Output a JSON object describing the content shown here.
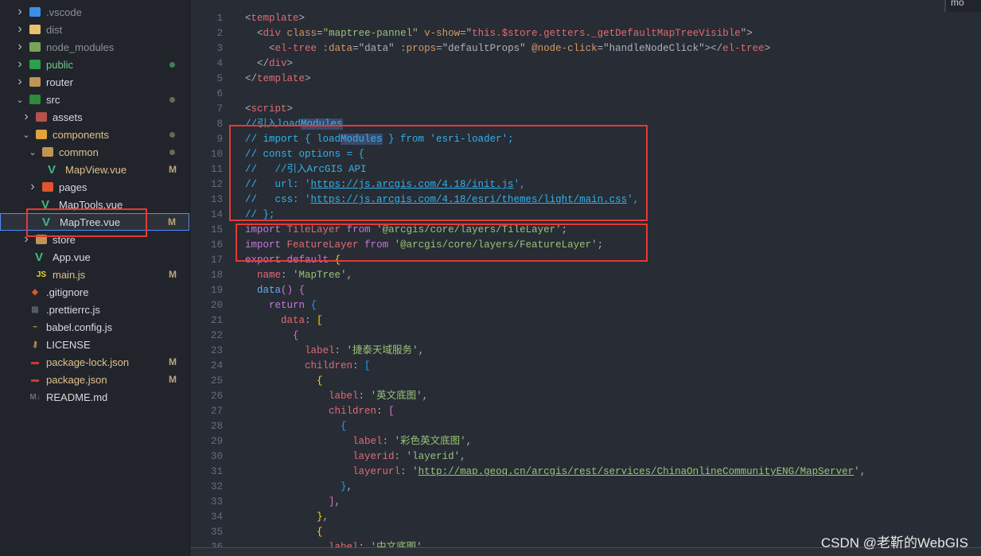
{
  "explorer": {
    "items": [
      {
        "name": ".vscode",
        "level": 0,
        "chevron": "closed",
        "icon": "vscode-folder-icon",
        "icon_color": "#3b8eea",
        "text_color": "#8b9099"
      },
      {
        "name": "dist",
        "level": 0,
        "chevron": "closed",
        "icon": "dist-folder-icon",
        "icon_color": "#e8c170",
        "text_color": "#8b9099"
      },
      {
        "name": "node_modules",
        "level": 0,
        "chevron": "closed",
        "icon": "node-folder-icon",
        "icon_color": "#7aa35a",
        "text_color": "#8b9099"
      },
      {
        "name": "public",
        "level": 0,
        "chevron": "closed",
        "icon": "public-folder-icon",
        "icon_color": "#2e9e4f",
        "text_color": "#73c991",
        "dot": "green"
      },
      {
        "name": "router",
        "level": 0,
        "chevron": "closed",
        "icon": "folder-icon",
        "icon_color": "#c09553",
        "text_color": "#d7dae0"
      },
      {
        "name": "src",
        "level": 0,
        "chevron": "open",
        "icon": "src-folder-icon",
        "icon_color": "#2e8b3e",
        "text_color": "#d7dae0",
        "dot": "gray"
      },
      {
        "name": "assets",
        "level": 1,
        "chevron": "closed",
        "icon": "assets-folder-icon",
        "icon_color": "#b5524b",
        "text_color": "#d7dae0"
      },
      {
        "name": "components",
        "level": 1,
        "chevron": "open",
        "icon": "components-folder-icon",
        "icon_color": "#e3a33b",
        "text_color": "#e2c08d",
        "dot": "gray"
      },
      {
        "name": "common",
        "level": 2,
        "chevron": "open",
        "icon": "folder-open-icon",
        "icon_color": "#c09553",
        "text_color": "#e2c08d",
        "dot": "gray"
      },
      {
        "name": "MapView.vue",
        "level": 3,
        "chevron": "none",
        "icon": "vue-icon",
        "icon_color": "#41b883",
        "text_color": "#e2c08d",
        "status": "M"
      },
      {
        "name": "pages",
        "level": 2,
        "chevron": "closed",
        "icon": "pages-folder-icon",
        "icon_color": "#e0552e",
        "text_color": "#d7dae0"
      },
      {
        "name": "MapTools.vue",
        "level": 2,
        "chevron": "none",
        "icon": "vue-icon",
        "icon_color": "#41b883",
        "text_color": "#d7dae0"
      },
      {
        "name": "MapTree.vue",
        "level": 2,
        "chevron": "none",
        "icon": "vue-icon",
        "icon_color": "#41b883",
        "text_color": "#d7dae0",
        "status": "M",
        "selected": true
      },
      {
        "name": "store",
        "level": 1,
        "chevron": "closed",
        "icon": "folder-icon",
        "icon_color": "#c09553",
        "text_color": "#d7dae0"
      },
      {
        "name": "App.vue",
        "level": 1,
        "chevron": "none",
        "icon": "vue-icon",
        "icon_color": "#41b883",
        "text_color": "#d7dae0"
      },
      {
        "name": "main.js",
        "level": 1,
        "chevron": "none",
        "icon": "js-icon",
        "icon_color": "#f0d52b",
        "text_color": "#e2c08d",
        "status": "M"
      },
      {
        "name": ".gitignore",
        "level": 0,
        "chevron": "none",
        "icon": "git-icon",
        "icon_color": "#e0552e",
        "text_color": "#d7dae0"
      },
      {
        "name": ".prettierrc.js",
        "level": 0,
        "chevron": "none",
        "icon": "prettier-icon",
        "icon_color": "#56616e",
        "text_color": "#d7dae0"
      },
      {
        "name": "babel.config.js",
        "level": 0,
        "chevron": "none",
        "icon": "babel-icon",
        "icon_color": "#c4a24b",
        "text_color": "#d7dae0"
      },
      {
        "name": "LICENSE",
        "level": 0,
        "chevron": "none",
        "icon": "license-icon",
        "icon_color": "#d3a247",
        "text_color": "#d7dae0"
      },
      {
        "name": "package-lock.json",
        "level": 0,
        "chevron": "none",
        "icon": "npm-icon",
        "icon_color": "#cb3837",
        "text_color": "#e2c08d",
        "status": "M"
      },
      {
        "name": "package.json",
        "level": 0,
        "chevron": "none",
        "icon": "npm-icon",
        "icon_color": "#cb3837",
        "text_color": "#e2c08d",
        "status": "M"
      },
      {
        "name": "README.md",
        "level": 0,
        "chevron": "none",
        "icon": "markdown-icon",
        "icon_color": "#6a6f78",
        "text_color": "#d7dae0"
      }
    ]
  },
  "editor": {
    "lines": [
      [
        [
          "p",
          "<"
        ],
        [
          "t",
          "template"
        ],
        [
          "p",
          ">"
        ]
      ],
      [
        [
          "p",
          "  <"
        ],
        [
          "t",
          "div"
        ],
        [
          "p",
          " "
        ],
        [
          "a",
          "class"
        ],
        [
          "p",
          "="
        ],
        [
          "s",
          "\"maptree-pannel\""
        ],
        [
          "p",
          " "
        ],
        [
          "a",
          "v-show"
        ],
        [
          "p",
          "=\""
        ],
        [
          "v",
          "this.$store.getters._getDefaultMapTreeVisible"
        ],
        [
          "p",
          "\">"
        ]
      ],
      [
        [
          "p",
          "    <"
        ],
        [
          "t",
          "el-tree"
        ],
        [
          "p",
          " "
        ],
        [
          "a",
          ":data"
        ],
        [
          "p",
          "=\"data\" "
        ],
        [
          "a",
          ":props"
        ],
        [
          "p",
          "=\"defaultProps\" "
        ],
        [
          "a",
          "@node-click"
        ],
        [
          "p",
          "=\"handleNodeClick\"></"
        ],
        [
          "t",
          "el-tree"
        ],
        [
          "p",
          ">"
        ]
      ],
      [
        [
          "p",
          "  </"
        ],
        [
          "t",
          "div"
        ],
        [
          "p",
          ">"
        ]
      ],
      [
        [
          "p",
          "</"
        ],
        [
          "t",
          "template"
        ],
        [
          "p",
          ">"
        ]
      ],
      [],
      [
        [
          "p",
          "<"
        ],
        [
          "t",
          "script"
        ],
        [
          "p",
          ">"
        ]
      ],
      [
        [
          "c",
          "//引入load"
        ],
        [
          "chl",
          "Modules"
        ]
      ],
      [
        [
          "c",
          "// import { load"
        ],
        [
          "chl",
          "Modules"
        ],
        [
          "c",
          " } from 'esri-loader';"
        ]
      ],
      [
        [
          "c",
          "// const options = {"
        ]
      ],
      [
        [
          "c",
          "//   //引入ArcGIS API"
        ]
      ],
      [
        [
          "c",
          "//   url: '"
        ],
        [
          "cu",
          "https://js.arcgis.com/4.18/init.js"
        ],
        [
          "c",
          "',"
        ]
      ],
      [
        [
          "c",
          "//   css: '"
        ],
        [
          "cu",
          "https://js.arcgis.com/4.18/esri/themes/light/main.css"
        ],
        [
          "c",
          "',"
        ]
      ],
      [
        [
          "c",
          "// };"
        ]
      ],
      [
        [
          "k",
          "import"
        ],
        [
          "p",
          " "
        ],
        [
          "v",
          "TileLayer"
        ],
        [
          "p",
          " "
        ],
        [
          "k",
          "from"
        ],
        [
          "p",
          " "
        ],
        [
          "s",
          "'@arcgis/core/layers/TileLayer'"
        ],
        [
          "p",
          ";"
        ]
      ],
      [
        [
          "k",
          "import"
        ],
        [
          "p",
          " "
        ],
        [
          "v",
          "FeatureLayer"
        ],
        [
          "p",
          " "
        ],
        [
          "k",
          "from"
        ],
        [
          "p",
          " "
        ],
        [
          "s",
          "'@arcgis/core/layers/FeatureLayer'"
        ],
        [
          "p",
          ";"
        ]
      ],
      [
        [
          "k",
          "export"
        ],
        [
          "p",
          " "
        ],
        [
          "k",
          "default"
        ],
        [
          "p",
          " "
        ],
        [
          "b1",
          "{"
        ]
      ],
      [
        [
          "p",
          "  "
        ],
        [
          "v",
          "name"
        ],
        [
          "p",
          ": "
        ],
        [
          "s",
          "'MapTree'"
        ],
        [
          "p",
          ","
        ]
      ],
      [
        [
          "p",
          "  "
        ],
        [
          "f",
          "data"
        ],
        [
          "b2",
          "()"
        ],
        [
          "p",
          " "
        ],
        [
          "b2",
          "{"
        ]
      ],
      [
        [
          "p",
          "    "
        ],
        [
          "k",
          "return"
        ],
        [
          "p",
          " "
        ],
        [
          "b3",
          "{"
        ]
      ],
      [
        [
          "p",
          "      "
        ],
        [
          "v",
          "data"
        ],
        [
          "p",
          ": "
        ],
        [
          "b1",
          "["
        ]
      ],
      [
        [
          "p",
          "        "
        ],
        [
          "b2",
          "{"
        ]
      ],
      [
        [
          "p",
          "          "
        ],
        [
          "v",
          "label"
        ],
        [
          "p",
          ": "
        ],
        [
          "s",
          "'捷泰天域服务'"
        ],
        [
          "p",
          ","
        ]
      ],
      [
        [
          "p",
          "          "
        ],
        [
          "v",
          "children"
        ],
        [
          "p",
          ": "
        ],
        [
          "b3",
          "["
        ]
      ],
      [
        [
          "p",
          "            "
        ],
        [
          "b1",
          "{"
        ]
      ],
      [
        [
          "p",
          "              "
        ],
        [
          "v",
          "label"
        ],
        [
          "p",
          ": "
        ],
        [
          "s",
          "'英文底图'"
        ],
        [
          "p",
          ","
        ]
      ],
      [
        [
          "p",
          "              "
        ],
        [
          "v",
          "children"
        ],
        [
          "p",
          ": "
        ],
        [
          "b2",
          "["
        ]
      ],
      [
        [
          "p",
          "                "
        ],
        [
          "b3",
          "{"
        ]
      ],
      [
        [
          "p",
          "                  "
        ],
        [
          "v",
          "label"
        ],
        [
          "p",
          ": "
        ],
        [
          "s",
          "'彩色英文底图'"
        ],
        [
          "p",
          ","
        ]
      ],
      [
        [
          "p",
          "                  "
        ],
        [
          "v",
          "layerid"
        ],
        [
          "p",
          ": "
        ],
        [
          "s",
          "'layerid'"
        ],
        [
          "p",
          ","
        ]
      ],
      [
        [
          "p",
          "                  "
        ],
        [
          "v",
          "layerurl"
        ],
        [
          "p",
          ": "
        ],
        [
          "s",
          "'"
        ],
        [
          "su",
          "http://map.geoq.cn/arcgis/rest/services/ChinaOnlineCommunityENG/MapServer"
        ],
        [
          "s",
          "'"
        ],
        [
          "p",
          ","
        ]
      ],
      [
        [
          "p",
          "                "
        ],
        [
          "b3",
          "}"
        ],
        [
          "p",
          ","
        ]
      ],
      [
        [
          "p",
          "              "
        ],
        [
          "b2",
          "]"
        ],
        [
          "p",
          ","
        ]
      ],
      [
        [
          "p",
          "            "
        ],
        [
          "b1",
          "}"
        ],
        [
          "p",
          ","
        ]
      ],
      [
        [
          "p",
          "            "
        ],
        [
          "b1",
          "{"
        ]
      ],
      [
        [
          "p",
          "              "
        ],
        [
          "v",
          "label"
        ],
        [
          "p",
          ": "
        ],
        [
          "s",
          "'中文底图'"
        ],
        [
          "p",
          ","
        ]
      ]
    ]
  },
  "widget_text": "mo",
  "watermark": "CSDN @老靳的WebGIS"
}
